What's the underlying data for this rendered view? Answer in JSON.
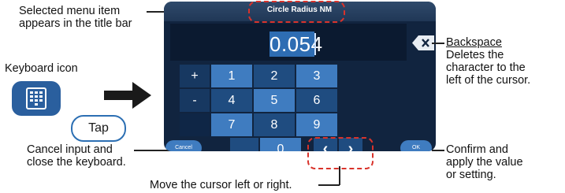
{
  "title_bar": {
    "text": "Circle Radius NM"
  },
  "display": {
    "value": "0.054"
  },
  "keypad": {
    "rows": [
      {
        "op": "+",
        "keys": [
          "1",
          "2",
          "3"
        ]
      },
      {
        "op": "-",
        "keys": [
          "4",
          "5",
          "6"
        ]
      },
      {
        "op": "",
        "keys": [
          "7",
          "8",
          "9"
        ]
      }
    ],
    "decimal": ".",
    "zero": "0",
    "cancel_label": "Cancel",
    "ok_label": "OK"
  },
  "keyboard_icon": {
    "label": "Keyboard icon",
    "tap_label": "Tap"
  },
  "annotations": {
    "selected_item": [
      "Selected menu item",
      "appears in the title bar"
    ],
    "backspace_title": "Backspace",
    "backspace_desc": [
      "Deletes the",
      "character to the",
      "left of the cursor."
    ],
    "cancel": [
      "Cancel input and",
      "close the keyboard."
    ],
    "confirm": [
      "Confirm and",
      "apply the value",
      "or setting."
    ],
    "cursor_move": "Move the cursor left or right."
  },
  "colors": {
    "screen_bg": "#11243f",
    "key_blue": "#3f7cc0",
    "highlight_red": "#d9332b"
  },
  "icons": {
    "backspace": "backspace-icon",
    "keyboard": "keyboard-icon",
    "arrow": "right-arrow-icon"
  }
}
